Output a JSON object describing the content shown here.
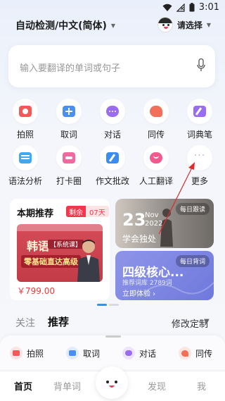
{
  "status": {
    "time": "3:01"
  },
  "header": {
    "language": "自动检测/中文(简体)",
    "user_label": "请选择"
  },
  "search": {
    "placeholder": "输入要翻译的单词或句子"
  },
  "features_row1": [
    {
      "label": "拍照",
      "icon": "camera-icon",
      "color": "#f25a5a"
    },
    {
      "label": "取词",
      "icon": "word-pick-icon",
      "color": "#4a90f0"
    },
    {
      "label": "对话",
      "icon": "chat-icon",
      "color": "#9a6cf0"
    },
    {
      "label": "同传",
      "icon": "simul-interpret-icon",
      "color": "#f2705a"
    },
    {
      "label": "词典笔",
      "icon": "dict-pen-icon",
      "color": "#9a6cf0"
    }
  ],
  "features_row2": [
    {
      "label": "语法分析",
      "icon": "grammar-icon",
      "color": "#3fa8f2"
    },
    {
      "label": "打卡圈",
      "icon": "checkin-icon",
      "color": "#f06aa0"
    },
    {
      "label": "作文批改",
      "icon": "essay-icon",
      "color": "#3c8cf0"
    },
    {
      "label": "人工翻译",
      "icon": "human-translate-icon",
      "color": "#f05a8c"
    },
    {
      "label": "更多",
      "icon": "more-icon",
      "color": "#b0b4c0"
    }
  ],
  "recommend": {
    "title": "本期推荐",
    "sale_tag": "剩余",
    "sale_count": "07天",
    "promo_t1": "韩语",
    "promo_t2": "【系统课】",
    "promo_t3": "零基础直达高级",
    "price": "￥799.00"
  },
  "daily_read": {
    "tag": "每日跟读",
    "day": "23",
    "month": "Nov",
    "year": "2022",
    "quote": "学会独处"
  },
  "daily_vocab": {
    "tag": "每日背词",
    "title": "四级核心...",
    "subtitle": "推荐词库 2789词",
    "button": "立即体验 ›"
  },
  "tabs": {
    "follow": "关注",
    "recommend": "推荐",
    "customize": "修改定制"
  },
  "quick_actions": [
    "拍照",
    "取词",
    "对话",
    "同传"
  ],
  "nav": {
    "home": "首页",
    "words": "背单词",
    "discover": "发现",
    "me": "我"
  }
}
